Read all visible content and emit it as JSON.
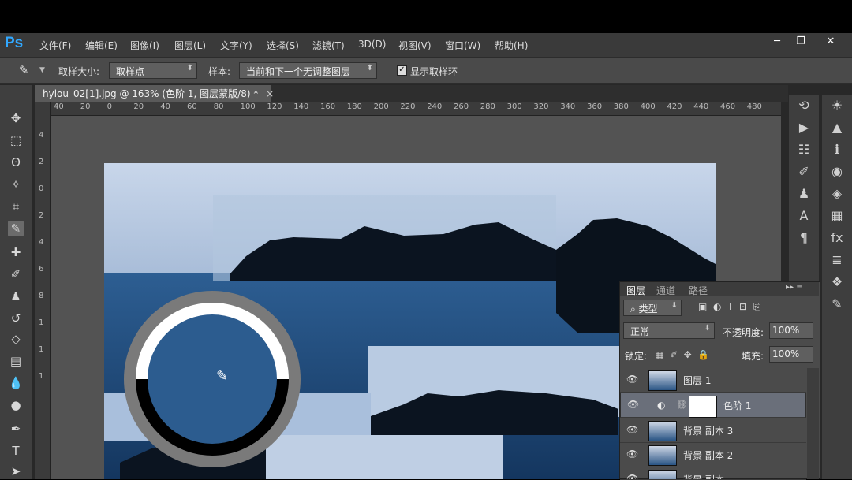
{
  "app": {
    "logo": "Ps"
  },
  "menu": [
    "文件(F)",
    "编辑(E)",
    "图像(I)",
    "图层(L)",
    "文字(Y)",
    "选择(S)",
    "滤镜(T)",
    "3D(D)",
    "视图(V)",
    "窗口(W)",
    "帮助(H)"
  ],
  "window_controls": {
    "minimize": "─",
    "restore": "❐",
    "close": "✕"
  },
  "options": {
    "sample_size_label": "取样大小:",
    "sample_size_value": "取样点",
    "sample_label": "样本:",
    "sample_value": "当前和下一个无调整图层",
    "show_ring_label": "显示取样环",
    "show_ring_checked": true
  },
  "document_tab": {
    "title": "hylou_02[1].jpg @ 163% (色阶 1, 图层蒙版/8) *",
    "close": "×"
  },
  "ruler_labels": [
    "40",
    "20",
    "0",
    "20",
    "40",
    "60",
    "80",
    "100",
    "120",
    "140",
    "160",
    "180",
    "200",
    "220",
    "240",
    "260",
    "280",
    "300",
    "320",
    "340",
    "360",
    "380",
    "400",
    "420",
    "440",
    "460",
    "480"
  ],
  "vruler_labels": [
    "4",
    "2",
    "0",
    "2",
    "4",
    "6",
    "8",
    "1",
    "1",
    "1"
  ],
  "layers_panel": {
    "tabs": [
      "图层",
      "通道",
      "路径"
    ],
    "filter_kind": "类型",
    "blend_mode": "正常",
    "opacity_label": "不透明度:",
    "opacity_value": "100%",
    "lock_label": "锁定:",
    "fill_label": "填充:",
    "fill_value": "100%",
    "layers": [
      {
        "name": "图层 1",
        "selected": false
      },
      {
        "name": "色阶 1",
        "selected": true
      },
      {
        "name": "背景 副本 3",
        "selected": false
      },
      {
        "name": "背景 副本 2",
        "selected": false
      },
      {
        "name": "背景 副本",
        "selected": false
      }
    ]
  },
  "colors": {
    "accent": "#31a8ff",
    "panel": "#4b4b4b",
    "menubar": "#3a3a3a"
  }
}
